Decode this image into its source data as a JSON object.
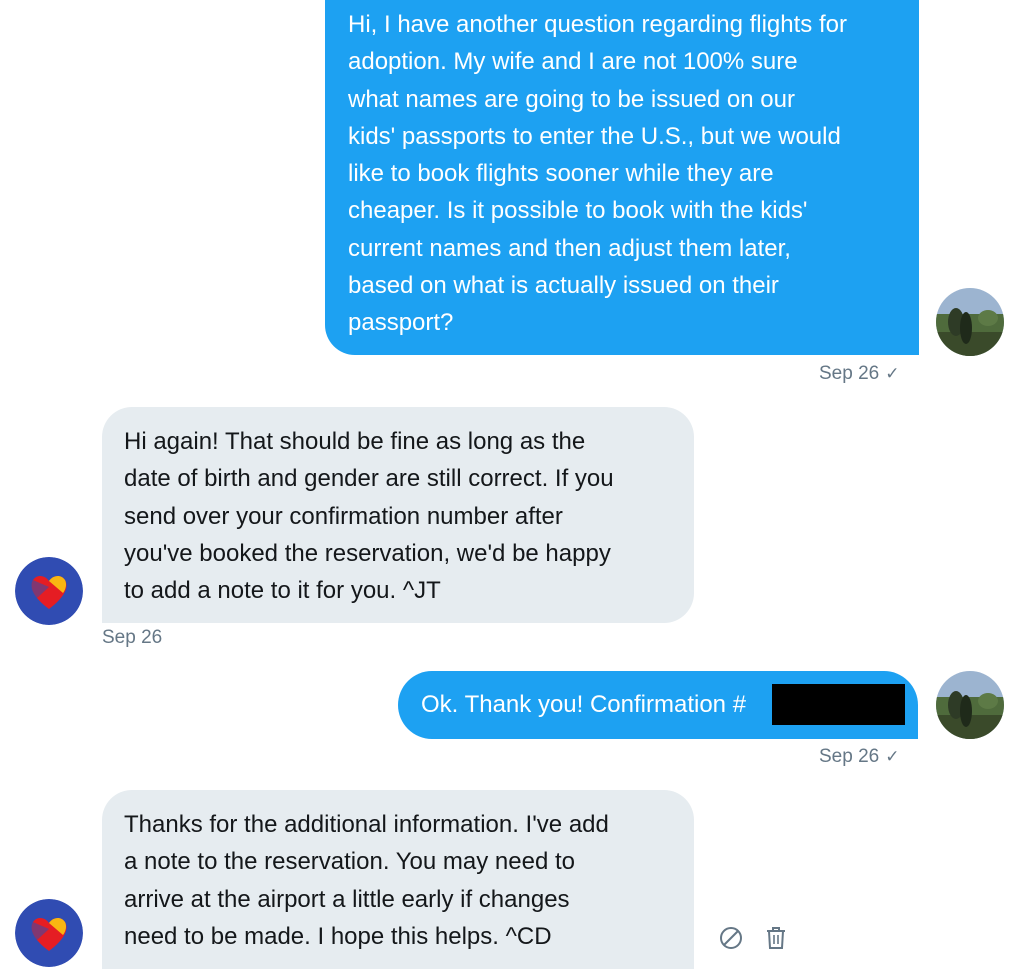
{
  "conversation": {
    "messages": [
      {
        "direction": "outgoing",
        "text": "Hi, I have another question regarding flights for\nadoption. My wife and I are not 100% sure\nwhat names are going to be issued on our\nkids' passports to enter the U.S., but we would\nlike to book flights sooner while they are\ncheaper. Is it possible to book with the kids'\ncurrent names and then adjust them later,\nbased on what is actually issued on their\npassport?",
        "timestamp": "Sep 26",
        "status_icon": "checkmark-icon"
      },
      {
        "direction": "incoming",
        "text": "Hi again! That should be fine as long as the\ndate of birth and gender are still correct. If you\nsend over your confirmation number after\nyou've booked the reservation, we'd be happy\nto add a note to it for you. ^JT",
        "timestamp": "Sep 26"
      },
      {
        "direction": "outgoing",
        "text": "Ok. Thank you! Confirmation #",
        "redacted": true,
        "timestamp": "Sep 26",
        "status_icon": "checkmark-icon"
      },
      {
        "direction": "incoming",
        "text": "Thanks for the additional information. I've add\na note to the reservation. You may need to\narrive at the airport a little early if changes\nneed to be made. I hope this helps. ^CD",
        "actions": [
          "block-icon",
          "trash-icon"
        ]
      }
    ],
    "colors": {
      "outgoing_bubble": "#1da1f2",
      "incoming_bubble": "#e6ecf0",
      "timestamp": "#657786",
      "brand_heart_blue": "#304cb2",
      "brand_heart_red": "#e51d23",
      "brand_heart_yellow": "#f9b612"
    }
  }
}
